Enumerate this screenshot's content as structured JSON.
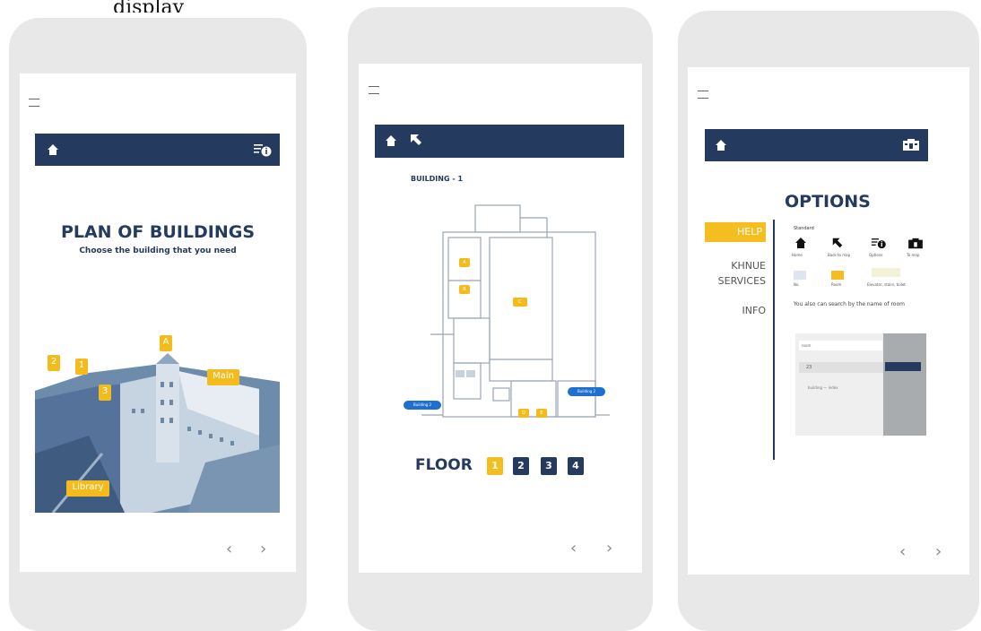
{
  "caption": "display",
  "screen1": {
    "title": "PLAN OF BUILDINGS",
    "subtitle": "Choose the building  that you need",
    "tags": [
      "2",
      "1",
      "A",
      "3",
      "Main",
      "Library"
    ],
    "pager_prev": "‹",
    "pager_next": "›"
  },
  "screen2": {
    "building_label": "BUILDING - 1",
    "floor_label": "FLOOR",
    "floors": [
      "1",
      "2",
      "3",
      "4"
    ],
    "active_floor": "1",
    "plan_tags": [
      "A",
      "B",
      "C",
      "D",
      "E"
    ],
    "link_left": "Building 2",
    "link_right": "Building 2",
    "pager_prev": "‹",
    "pager_next": "›"
  },
  "screen3": {
    "title": "OPTIONS",
    "menu": [
      "HELP",
      "KHNUE SERVICES",
      "INFO"
    ],
    "help_heading": "Standard",
    "icon_captions": [
      "Home",
      "Back to map",
      "Options",
      "To map"
    ],
    "row2_captions": [
      "No.",
      "Room",
      "Elevator, stairs, toilet"
    ],
    "search_hint": "You also can search by the name of room",
    "search_box": "room",
    "search_result": "23",
    "search_suggestion": "building — index",
    "pager_prev": "‹",
    "pager_next": "›"
  },
  "colors": {
    "navy": "#243a5e",
    "yellow": "#f5be20",
    "frame": "#e8e8e8"
  }
}
